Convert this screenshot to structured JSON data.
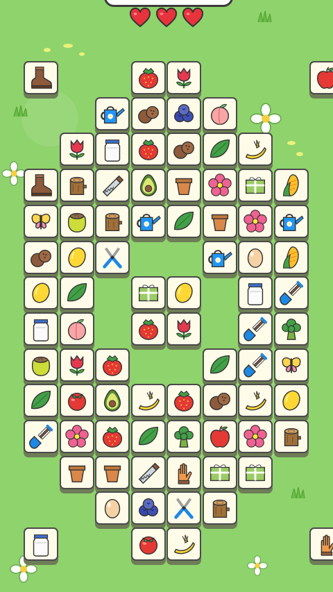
{
  "game": {
    "lives": 3,
    "colors": {
      "background": "#8fd36c",
      "tile_face": "#fffbe9",
      "tile_side": "#6e7d57",
      "heart": "#e8333d"
    }
  },
  "tiles": [
    {
      "name": "boot",
      "r": 0,
      "c": 0
    },
    {
      "name": "strawberry",
      "r": 0,
      "c": 3
    },
    {
      "name": "tulip",
      "r": 0,
      "c": 4
    },
    {
      "name": "apple",
      "r": 0,
      "c": 8
    },
    {
      "name": "watering-can",
      "r": 1,
      "c": 2
    },
    {
      "name": "coconut",
      "r": 1,
      "c": 3
    },
    {
      "name": "blueberries",
      "r": 1,
      "c": 4
    },
    {
      "name": "peach",
      "r": 1,
      "c": 5
    },
    {
      "name": "tulip",
      "r": 2,
      "c": 1
    },
    {
      "name": "milk-jar",
      "r": 2,
      "c": 2
    },
    {
      "name": "strawberry",
      "r": 2,
      "c": 3
    },
    {
      "name": "coconut",
      "r": 2,
      "c": 4
    },
    {
      "name": "leaf",
      "r": 2,
      "c": 5
    },
    {
      "name": "banana",
      "r": 2,
      "c": 6
    },
    {
      "name": "boot",
      "r": 3,
      "c": 0
    },
    {
      "name": "stump",
      "r": 3,
      "c": 1
    },
    {
      "name": "saw",
      "r": 3,
      "c": 2
    },
    {
      "name": "avocado",
      "r": 3,
      "c": 3
    },
    {
      "name": "flowerpot",
      "r": 3,
      "c": 4
    },
    {
      "name": "pink-flower",
      "r": 3,
      "c": 5
    },
    {
      "name": "gift",
      "r": 3,
      "c": 6
    },
    {
      "name": "corn",
      "r": 3,
      "c": 7
    },
    {
      "name": "butterfly",
      "r": 4,
      "c": 0
    },
    {
      "name": "seed-sack",
      "r": 4,
      "c": 1
    },
    {
      "name": "stump",
      "r": 4,
      "c": 2
    },
    {
      "name": "watering-can",
      "r": 4,
      "c": 3
    },
    {
      "name": "leaf",
      "r": 4,
      "c": 4
    },
    {
      "name": "flowerpot",
      "r": 4,
      "c": 5
    },
    {
      "name": "pink-flower",
      "r": 4,
      "c": 6
    },
    {
      "name": "watering-can",
      "r": 4,
      "c": 7
    },
    {
      "name": "coconut",
      "r": 5,
      "c": 0
    },
    {
      "name": "lemon",
      "r": 5,
      "c": 1
    },
    {
      "name": "pruner",
      "r": 5,
      "c": 2
    },
    {
      "name": "watering-can",
      "r": 5,
      "c": 5
    },
    {
      "name": "egg",
      "r": 5,
      "c": 6
    },
    {
      "name": "corn",
      "r": 5,
      "c": 7
    },
    {
      "name": "lemon",
      "r": 6,
      "c": 0
    },
    {
      "name": "leaf",
      "r": 6,
      "c": 1
    },
    {
      "name": "gift",
      "r": 6,
      "c": 3
    },
    {
      "name": "lemon",
      "r": 6,
      "c": 4
    },
    {
      "name": "milk-jar",
      "r": 6,
      "c": 6
    },
    {
      "name": "shovel",
      "r": 6,
      "c": 7
    },
    {
      "name": "milk-jar",
      "r": 7,
      "c": 0
    },
    {
      "name": "peach",
      "r": 7,
      "c": 1
    },
    {
      "name": "strawberry",
      "r": 7,
      "c": 3
    },
    {
      "name": "tulip",
      "r": 7,
      "c": 4
    },
    {
      "name": "shovel",
      "r": 7,
      "c": 6
    },
    {
      "name": "broccoli",
      "r": 7,
      "c": 7
    },
    {
      "name": "seed-sack",
      "r": 8,
      "c": 0
    },
    {
      "name": "tulip",
      "r": 8,
      "c": 1
    },
    {
      "name": "strawberry",
      "r": 8,
      "c": 2
    },
    {
      "name": "leaf",
      "r": 8,
      "c": 5
    },
    {
      "name": "shovel",
      "r": 8,
      "c": 6
    },
    {
      "name": "butterfly",
      "r": 8,
      "c": 7
    },
    {
      "name": "leaf",
      "r": 9,
      "c": 0
    },
    {
      "name": "tomato",
      "r": 9,
      "c": 1
    },
    {
      "name": "avocado",
      "r": 9,
      "c": 2
    },
    {
      "name": "banana",
      "r": 9,
      "c": 3
    },
    {
      "name": "strawberry",
      "r": 9,
      "c": 4
    },
    {
      "name": "coconut",
      "r": 9,
      "c": 5
    },
    {
      "name": "banana",
      "r": 9,
      "c": 6
    },
    {
      "name": "lemon",
      "r": 9,
      "c": 7
    },
    {
      "name": "shovel",
      "r": 10,
      "c": 0
    },
    {
      "name": "pink-flower",
      "r": 10,
      "c": 1
    },
    {
      "name": "strawberry",
      "r": 10,
      "c": 2
    },
    {
      "name": "leaf",
      "r": 10,
      "c": 3
    },
    {
      "name": "broccoli",
      "r": 10,
      "c": 4
    },
    {
      "name": "apple",
      "r": 10,
      "c": 5
    },
    {
      "name": "pink-flower",
      "r": 10,
      "c": 6
    },
    {
      "name": "stump",
      "r": 10,
      "c": 7
    },
    {
      "name": "flowerpot",
      "r": 11,
      "c": 1
    },
    {
      "name": "flowerpot",
      "r": 11,
      "c": 2
    },
    {
      "name": "saw",
      "r": 11,
      "c": 3
    },
    {
      "name": "glove",
      "r": 11,
      "c": 4
    },
    {
      "name": "gift",
      "r": 11,
      "c": 5
    },
    {
      "name": "gift",
      "r": 11,
      "c": 6
    },
    {
      "name": "egg",
      "r": 12,
      "c": 2
    },
    {
      "name": "blueberries",
      "r": 12,
      "c": 3
    },
    {
      "name": "pruner",
      "r": 12,
      "c": 4
    },
    {
      "name": "stump",
      "r": 12,
      "c": 5
    },
    {
      "name": "milk-jar",
      "r": 13,
      "c": 0
    },
    {
      "name": "tomato",
      "r": 13,
      "c": 3
    },
    {
      "name": "banana",
      "r": 13,
      "c": 4
    },
    {
      "name": "glove",
      "r": 13,
      "c": 8
    }
  ]
}
